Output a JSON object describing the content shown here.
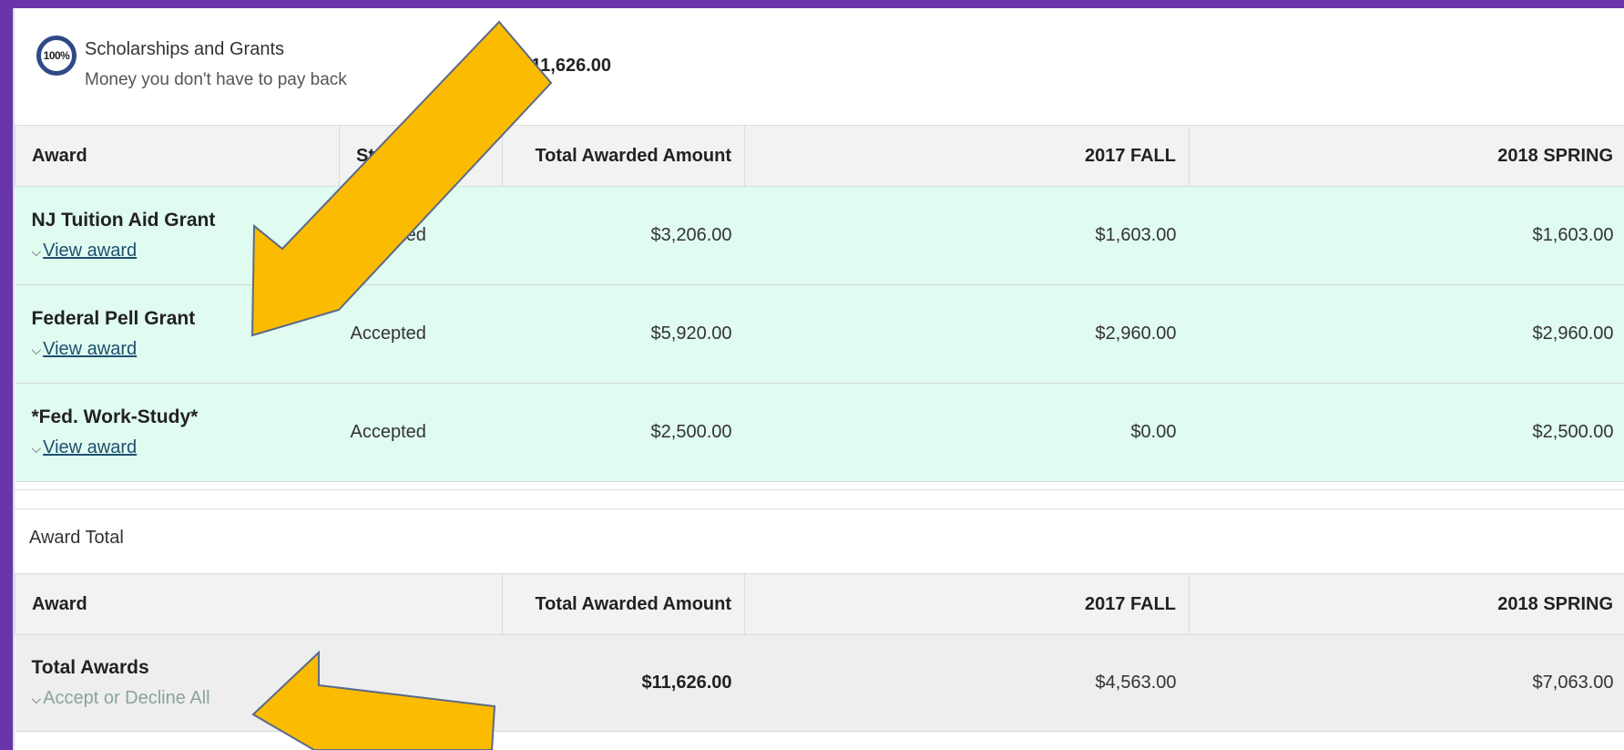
{
  "summary": {
    "progress_text": "100%",
    "title": "Scholarships and Grants",
    "subtitle": "Money you don't have to pay back",
    "amount": "$11,626.00"
  },
  "awards_table": {
    "headers": [
      "Award",
      "Status",
      "Total Awarded Amount",
      "2017 FALL",
      "2018 SPRING"
    ],
    "rows": [
      {
        "name": "NJ Tuition Aid Grant",
        "link": "View award",
        "status": "Accepted",
        "total": "$3,206.00",
        "fall": "$1,603.00",
        "spring": "$1,603.00"
      },
      {
        "name": "Federal Pell Grant",
        "link": "View award",
        "status": "Accepted",
        "total": "$5,920.00",
        "fall": "$2,960.00",
        "spring": "$2,960.00"
      },
      {
        "name": "*Fed. Work-Study*",
        "link": "View award",
        "status": "Accepted",
        "total": "$2,500.00",
        "fall": "$0.00",
        "spring": "$2,500.00"
      }
    ]
  },
  "award_total": {
    "label": "Award Total",
    "headers": [
      "Award",
      "Total Awarded Amount",
      "2017 FALL",
      "2018 SPRING"
    ],
    "row": {
      "name": "Total Awards",
      "link": "Accept or Decline All",
      "total": "$11,626.00",
      "fall": "$4,563.00",
      "spring": "$7,063.00"
    }
  },
  "colors": {
    "background": "#6a35a8",
    "award_row": "#e0fbf0",
    "arrow": "#fbbb00"
  },
  "icons": {
    "chevron": "chevron-down-icon",
    "annotation": "arrow-annotation"
  }
}
